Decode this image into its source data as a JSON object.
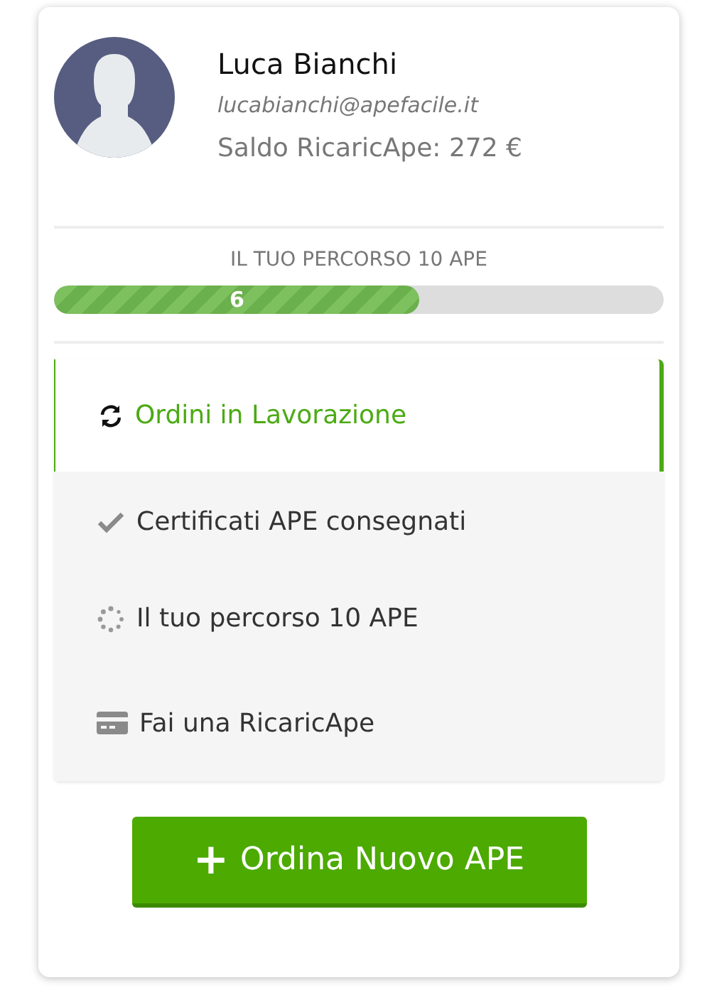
{
  "profile": {
    "name": "Luca Bianchi",
    "email": "lucabianchi@apefacile.it",
    "balance_label": "Saldo RicaricApe:",
    "balance_value": "272 €"
  },
  "progress": {
    "title": "IL TUO PERCORSO 10 APE",
    "level": 0.6,
    "reading": "6"
  },
  "menu": [
    {
      "kind": "refresh",
      "label": "Ordini in Lavorazione",
      "selected": true
    },
    {
      "kind": "check",
      "label": "Certificati APE consegnati",
      "selected": false
    },
    {
      "kind": "spinner",
      "label": "Il tuo percorso 10 APE",
      "selected": false
    },
    {
      "kind": "card",
      "label": "Fai una RicaricApe",
      "selected": false
    }
  ],
  "action_button": {
    "icon": "+",
    "label": "Ordina Nuovo APE"
  }
}
